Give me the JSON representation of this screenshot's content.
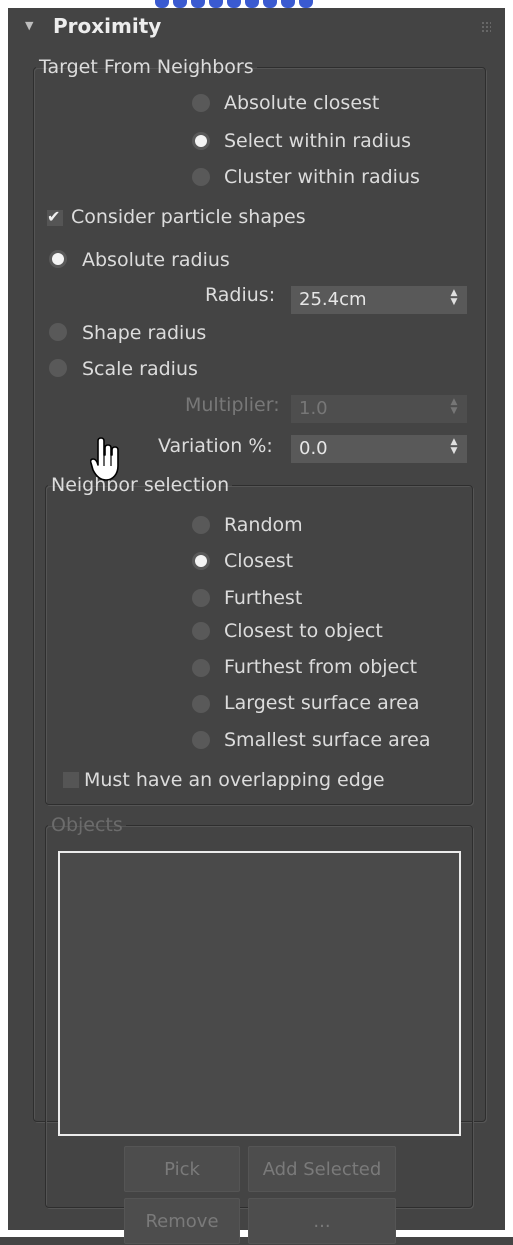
{
  "rollout": {
    "title": "Proximity",
    "collapse_icon": "triangle-down-icon",
    "grip_icon": "grip-dots-icon"
  },
  "target_from_neighbors": {
    "legend": "Target From Neighbors",
    "modes": [
      {
        "label": "Absolute closest",
        "selected": false
      },
      {
        "label": "Select within radius",
        "selected": true
      },
      {
        "label": "Cluster within radius",
        "selected": false
      }
    ],
    "consider_particle_shapes": {
      "label": "Consider particle shapes",
      "checked": true
    },
    "radius_modes": [
      {
        "label": "Absolute radius",
        "selected": true
      },
      {
        "label": "Shape radius",
        "selected": false
      },
      {
        "label": "Scale radius",
        "selected": false
      }
    ],
    "radius": {
      "label": "Radius:",
      "value": "25.4cm"
    },
    "multiplier": {
      "label": "Multiplier:",
      "value": "1.0",
      "enabled": false
    },
    "variation": {
      "label": "Variation %:",
      "value": "0.0"
    }
  },
  "neighbor_selection": {
    "legend": "Neighbor selection",
    "options": [
      {
        "label": "Random",
        "selected": false
      },
      {
        "label": "Closest",
        "selected": true
      },
      {
        "label": "Furthest",
        "selected": false
      },
      {
        "label": "Closest to object",
        "selected": false
      },
      {
        "label": "Furthest from object",
        "selected": false
      },
      {
        "label": "Largest surface area",
        "selected": false
      },
      {
        "label": "Smallest surface area",
        "selected": false
      }
    ],
    "must_have_overlapping_edge": {
      "label": "Must have an overlapping edge",
      "checked": false
    }
  },
  "objects": {
    "legend": "Objects",
    "enabled": false,
    "buttons": {
      "pick": "Pick",
      "add_selected": "Add Selected",
      "remove": "Remove",
      "more": "..."
    }
  },
  "cursor": {
    "icon": "hand-pointer-icon"
  }
}
